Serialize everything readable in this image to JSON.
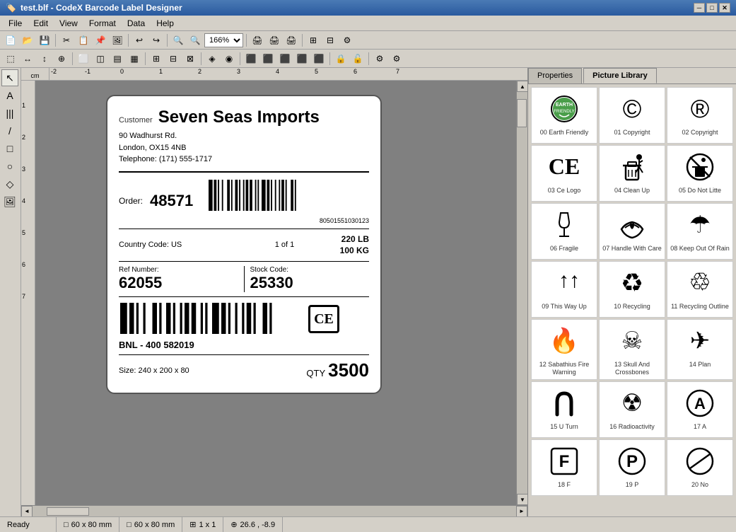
{
  "titlebar": {
    "title": "test.blf - CodeX Barcode Label Designer",
    "icon": "🏷️"
  },
  "menu": {
    "items": [
      "File",
      "Edit",
      "View",
      "Format",
      "Data",
      "Help"
    ]
  },
  "toolbar": {
    "zoom": "166%"
  },
  "label": {
    "customer_label": "Customer",
    "company": "Seven Seas Imports",
    "address1": "90 Wadhurst Rd.",
    "address2": "London, OX15 4NB",
    "phone": "Telephone: (171) 555-1717",
    "order_label": "Order:",
    "order_num": "48571",
    "barcode_num": "80501551030123",
    "country_label": "Country Code: US",
    "of_label": "1 of 1",
    "weight1": "220 LB",
    "weight2": "100 KG",
    "ref_label": "Ref Number:",
    "ref_val": "62055",
    "stock_label": "Stock Code:",
    "stock_val": "25330",
    "bnl": "BNL - 400 582019",
    "size_label": "Size: 240 x 200 x 80",
    "qty_label": "QTY",
    "qty_val": "3500"
  },
  "tabs": [
    {
      "id": "properties",
      "label": "Properties"
    },
    {
      "id": "picture-library",
      "label": "Picture Library",
      "active": true
    }
  ],
  "picture_library": [
    {
      "id": 0,
      "label": "00 Earth Friendly",
      "icon": "🌿"
    },
    {
      "id": 1,
      "label": "01 Copyright",
      "icon": "©"
    },
    {
      "id": 2,
      "label": "02 Copyright",
      "icon": "®"
    },
    {
      "id": 3,
      "label": "03 Ce Logo",
      "icon": "ce"
    },
    {
      "id": 4,
      "label": "04 Clean Up",
      "icon": "🗑"
    },
    {
      "id": 5,
      "label": "05 Do Not Litte",
      "icon": "🚯"
    },
    {
      "id": 6,
      "label": "06 Fragile",
      "icon": "fragile"
    },
    {
      "id": 7,
      "label": "07 Handle With Care",
      "icon": "handle"
    },
    {
      "id": 8,
      "label": "08 Keep Out Of Rain",
      "icon": "☂"
    },
    {
      "id": 9,
      "label": "09 This Way Up",
      "icon": "↑↑"
    },
    {
      "id": 10,
      "label": "10 Recycling",
      "icon": "♻"
    },
    {
      "id": 11,
      "label": "11 Recycling Outline",
      "icon": "recycle"
    },
    {
      "id": 12,
      "label": "12 Sabathius Fire Warning",
      "icon": "🔥"
    },
    {
      "id": 13,
      "label": "13 Skull And Crossbones",
      "icon": "☠"
    },
    {
      "id": 14,
      "label": "14 Plan",
      "icon": "✈"
    },
    {
      "id": 15,
      "label": "15 U Turn",
      "icon": "uturn"
    },
    {
      "id": 16,
      "label": "16 Radioactivity",
      "icon": "☢"
    },
    {
      "id": 17,
      "label": "17 A",
      "icon": "Ⓐ"
    }
  ],
  "statusbar": {
    "status": "Ready",
    "size1": "60 x 80 mm",
    "size2": "60 x 80 mm",
    "pages": "1 x 1",
    "coords": "26.6 , -8.9"
  }
}
